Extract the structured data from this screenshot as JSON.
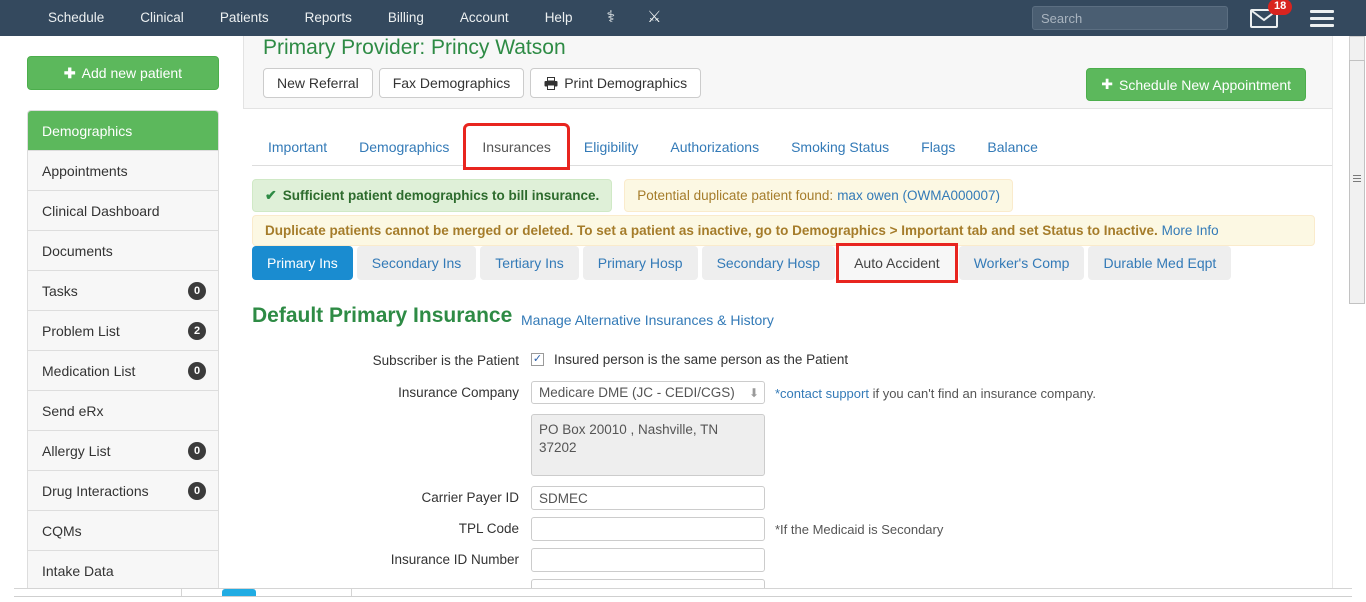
{
  "topnav": {
    "links": [
      "Schedule",
      "Clinical",
      "Patients",
      "Reports",
      "Billing",
      "Account",
      "Help"
    ],
    "icons": [
      {
        "name": "caduceus-icon",
        "glyph": "⚕"
      },
      {
        "name": "crossed-instruments-icon",
        "glyph": "⚔"
      }
    ],
    "search_placeholder": "Search",
    "search_value": "",
    "mail_badge": "18",
    "bg_color": "#34495e"
  },
  "sidebar": {
    "add_patient_label": "Add new patient",
    "items": [
      {
        "label": "Demographics",
        "badge": "",
        "active": true
      },
      {
        "label": "Appointments",
        "badge": "",
        "active": false
      },
      {
        "label": "Clinical Dashboard",
        "badge": "",
        "active": false
      },
      {
        "label": "Documents",
        "badge": "",
        "active": false
      },
      {
        "label": "Tasks",
        "badge": "0",
        "active": false
      },
      {
        "label": "Problem List",
        "badge": "2",
        "active": false
      },
      {
        "label": "Medication List",
        "badge": "0",
        "active": false
      },
      {
        "label": "Send eRx",
        "badge": "",
        "active": false
      },
      {
        "label": "Allergy List",
        "badge": "0",
        "active": false
      },
      {
        "label": "Drug Interactions",
        "badge": "0",
        "active": false
      },
      {
        "label": "CQMs",
        "badge": "",
        "active": false
      },
      {
        "label": "Intake Data",
        "badge": "",
        "active": false
      }
    ]
  },
  "header": {
    "provider_title": "Primary Provider: Princy Watson",
    "buttons": [
      {
        "label": "New Referral",
        "icon": ""
      },
      {
        "label": "Fax Demographics",
        "icon": ""
      },
      {
        "label": "Print Demographics",
        "icon": "printer-icon"
      }
    ],
    "schedule_button": "Schedule New Appointment"
  },
  "tabs": [
    {
      "label": "Important",
      "active": false,
      "highlighted": false
    },
    {
      "label": "Demographics",
      "active": false,
      "highlighted": false
    },
    {
      "label": "Insurances",
      "active": true,
      "highlighted": true
    },
    {
      "label": "Eligibility",
      "active": false,
      "highlighted": false
    },
    {
      "label": "Authorizations",
      "active": false,
      "highlighted": false
    },
    {
      "label": "Smoking Status",
      "active": false,
      "highlighted": false
    },
    {
      "label": "Flags",
      "active": false,
      "highlighted": false
    },
    {
      "label": "Balance",
      "active": false,
      "highlighted": false
    }
  ],
  "alerts": {
    "success": "Sufficient patient demographics to bill insurance.",
    "duplicate_prefix": "Potential duplicate patient found:",
    "duplicate_link": "max owen (OWMA000007)",
    "warning": "Duplicate patients cannot be merged or deleted. To set a patient as inactive, go to Demographics > Important tab and set Status to Inactive.",
    "warning_link": "More Info"
  },
  "pills": [
    {
      "label": "Primary Ins",
      "active": true,
      "highlighted": false
    },
    {
      "label": "Secondary Ins",
      "active": false,
      "highlighted": false
    },
    {
      "label": "Tertiary Ins",
      "active": false,
      "highlighted": false
    },
    {
      "label": "Primary Hosp",
      "active": false,
      "highlighted": false
    },
    {
      "label": "Secondary Hosp",
      "active": false,
      "highlighted": false
    },
    {
      "label": "Auto Accident",
      "active": false,
      "highlighted": true
    },
    {
      "label": "Worker's Comp",
      "active": false,
      "highlighted": false
    },
    {
      "label": "Durable Med Eqpt",
      "active": false,
      "highlighted": false
    }
  ],
  "form": {
    "section_title": "Default Primary Insurance",
    "manage_link": "Manage Alternative Insurances & History",
    "subscriber_label": "Subscriber is the Patient",
    "subscriber_checked": true,
    "subscriber_text": "Insured person is the same person as the Patient",
    "company_label": "Insurance Company",
    "company_value": "Medicare DME (JC - CEDI/CGS)",
    "company_hint_link": "*contact support",
    "company_hint_rest": "if you can't find an insurance company.",
    "address_value": "PO Box 20010 , Nashville, TN 37202",
    "payer_label": "Carrier Payer ID",
    "payer_value": "SDMEC",
    "tpl_label": "TPL Code",
    "tpl_value": "",
    "tpl_hint": "*If the Medicaid is Secondary",
    "insurance_id_label": "Insurance ID Number",
    "insurance_id_value": ""
  },
  "colors": {
    "nav_bg": "#34495e",
    "green": "#5cb85c",
    "link_blue": "#337ab7",
    "pill_active": "#1a8cd0",
    "highlight_red": "#e8251f",
    "title_green": "#2e8b45"
  }
}
